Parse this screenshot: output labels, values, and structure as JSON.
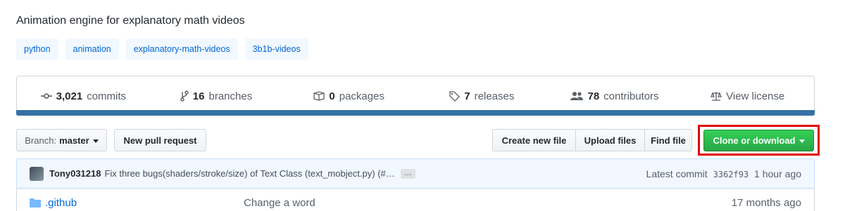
{
  "repo": {
    "description": "Animation engine for explanatory math videos",
    "topics": [
      "python",
      "animation",
      "explanatory-math-videos",
      "3b1b-videos"
    ]
  },
  "summary": {
    "commits_count": "3,021",
    "commits_label": "commits",
    "branches_count": "16",
    "branches_label": "branches",
    "packages_count": "0",
    "packages_label": "packages",
    "releases_count": "7",
    "releases_label": "releases",
    "contributors_count": "78",
    "contributors_label": "contributors",
    "license_label": "View license"
  },
  "colors": {
    "language_bar": "#3572A5",
    "clone_button": "#2ea44f",
    "highlight": "#e00000"
  },
  "toolbar": {
    "branch_prefix": "Branch:",
    "branch_name": "master",
    "new_pull_request": "New pull request",
    "create_new_file": "Create new file",
    "upload_files": "Upload files",
    "find_file": "Find file",
    "clone_or_download": "Clone or download"
  },
  "latest_commit": {
    "author": "Tony031218",
    "message": "Fix three bugs(shaders/stroke/size) of Text Class (text_mobject.py) (#…",
    "ellipsis": "…",
    "prefix": "Latest commit",
    "sha": "3362f93",
    "age": "1 hour ago"
  },
  "files": [
    {
      "icon": "folder-icon",
      "name": ".github",
      "message": "Change a word",
      "age": "17 months ago"
    }
  ]
}
